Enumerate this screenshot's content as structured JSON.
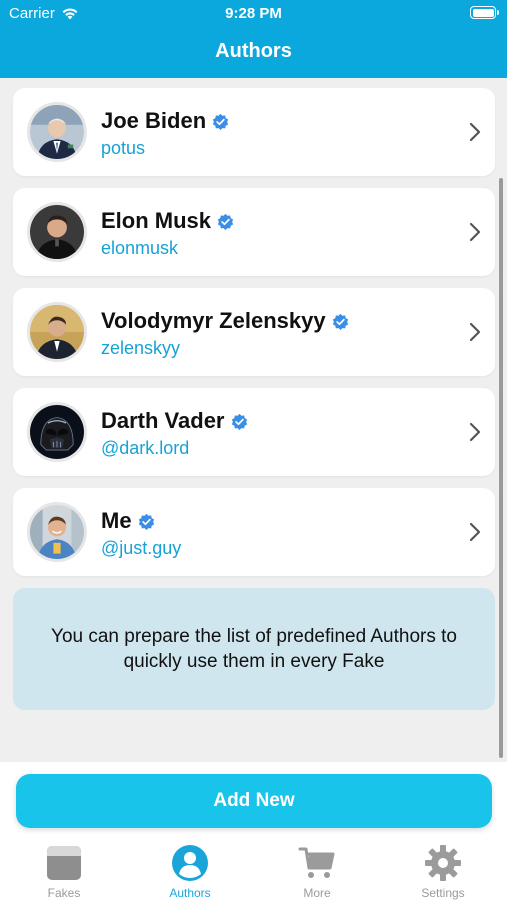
{
  "status_bar": {
    "carrier": "Carrier",
    "time": "9:28 PM",
    "battery_level": 1.0
  },
  "nav": {
    "title": "Authors"
  },
  "authors": [
    {
      "name": "Joe Biden",
      "handle": "potus",
      "avatar": "man-in-suit-photo"
    },
    {
      "name": "Elon Musk",
      "handle": "elonmusk",
      "avatar": "man-portrait-photo"
    },
    {
      "name": "Volodymyr Zelenskyy",
      "handle": "zelenskyy",
      "avatar": "man-in-suit-photo"
    },
    {
      "name": "Darth Vader",
      "handle": "@dark.lord",
      "avatar": "dark-helmet-photo"
    },
    {
      "name": "Me",
      "handle": "@just.guy",
      "avatar": "smiling-guy-photo"
    }
  ],
  "info": {
    "text": "You can prepare the list of predefined Authors to quickly use them in every Fake"
  },
  "actions": {
    "add_new_label": "Add New"
  },
  "tabs": [
    {
      "label": "Fakes",
      "icon": "fakes-icon",
      "active": false
    },
    {
      "label": "Authors",
      "icon": "person-circle-icon",
      "active": true
    },
    {
      "label": "More",
      "icon": "cart-icon",
      "active": false
    },
    {
      "label": "Settings",
      "icon": "gear-icon",
      "active": false
    }
  ],
  "colors": {
    "header": "#0aa8dd",
    "accent": "#17a2d6",
    "button": "#18c4ea",
    "verified": "#3a8ee6",
    "info_bg": "#cfe6ee"
  }
}
